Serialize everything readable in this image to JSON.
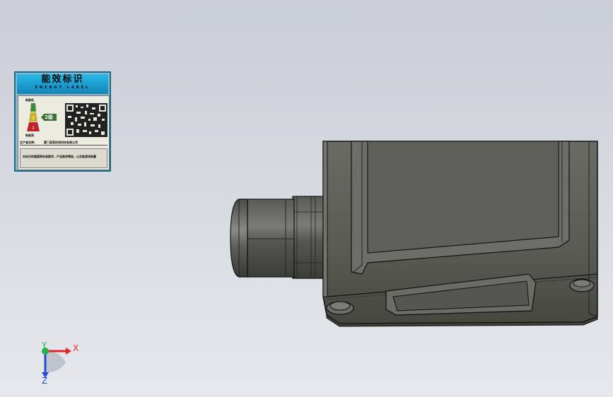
{
  "viewport": {
    "background_top": "#c9ced6",
    "background_bottom": "#e6e8ec"
  },
  "energy_label": {
    "title_cn": "能效标识",
    "title_en": "ENERGY LABEL",
    "grade_top_caption": "耗能低",
    "grade_bottom_caption": "耗能高",
    "grade_levels": [
      "1",
      "2",
      "3"
    ],
    "grade_value": "2级",
    "producer_label": "生产者名称:",
    "producer_value": "厦门某某机电科技有限公司",
    "footer_text": "本标识依据国家标准要求，产品能效等级，以及能源消耗量"
  },
  "part": {
    "body_color": "#5b5c55",
    "gland_color": "#4e4f49",
    "outline_color": "#111111"
  },
  "triad": {
    "x_label": "X",
    "y_label": "Y",
    "z_label": "Z",
    "x_color": "#e3262a",
    "y_color": "#22b14c",
    "z_color": "#2a4bd4"
  }
}
